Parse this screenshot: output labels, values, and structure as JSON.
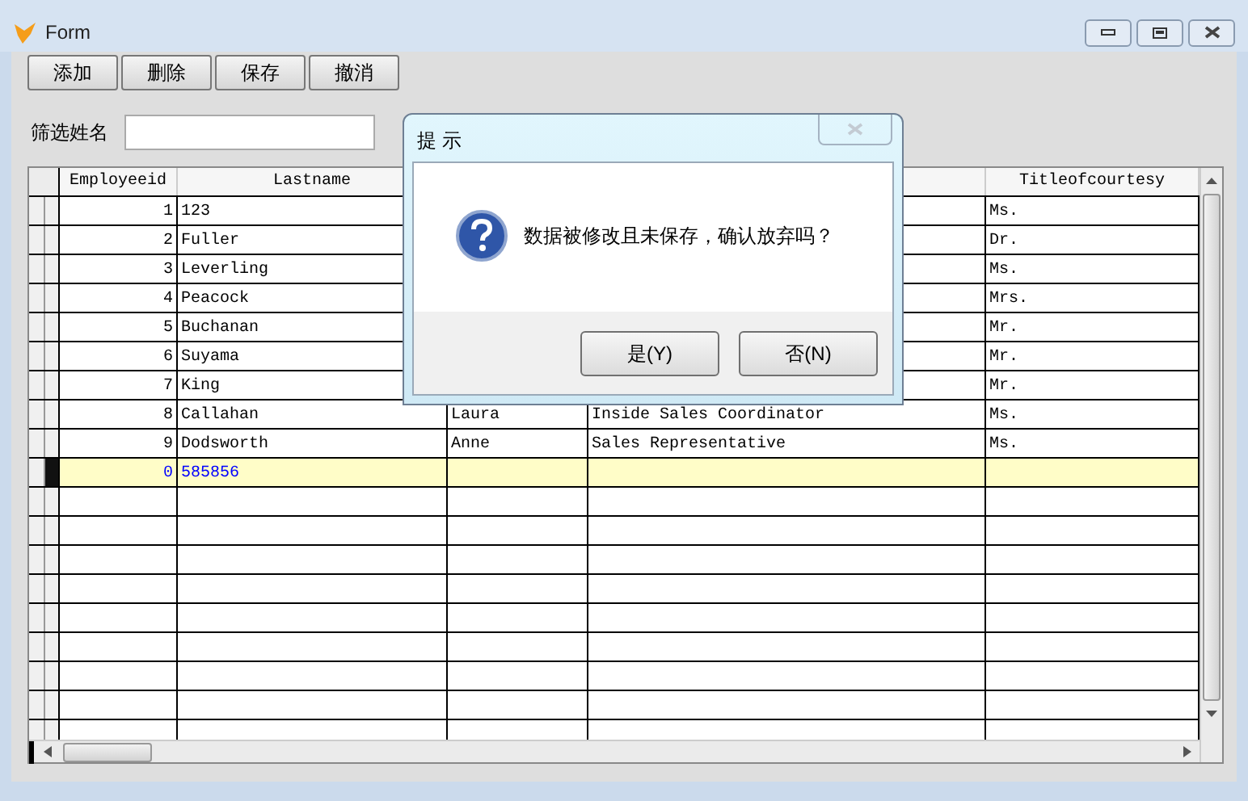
{
  "window": {
    "title": "Form"
  },
  "toolbar": [
    "添加",
    "删除",
    "保存",
    "撤消"
  ],
  "filter": {
    "label": "筛选姓名"
  },
  "table": {
    "headings": {
      "column_1": "Employeeid",
      "column_2": "Lastname",
      "column_5": "Titleofcourtesy"
    },
    "rows": [
      {
        "column_1": "1",
        "column_2": "123",
        "column_5": "Ms.",
        "selected": false
      },
      {
        "column_1": "2",
        "column_2": "Fuller",
        "column_5": "Dr.",
        "selected": false
      },
      {
        "column_1": "3",
        "column_2": "Leverling",
        "column_5": "Ms.",
        "selected": false
      },
      {
        "column_1": "4",
        "column_2": "Peacock",
        "column_5": "Mrs.",
        "selected": false
      },
      {
        "column_1": "5",
        "column_2": "Buchanan",
        "column_5": "Mr.",
        "selected": false
      },
      {
        "column_1": "6",
        "column_2": "Suyama",
        "column_5": "Mr.",
        "selected": false
      },
      {
        "column_1": "7",
        "column_2": "King",
        "column_5": "Mr.",
        "selected": false
      },
      {
        "column_1": "8",
        "column_2": "Callahan",
        "column_3": "Laura",
        "column_4": "Inside Sales Coordinator",
        "column_5": "Ms.",
        "selected": false
      },
      {
        "column_1": "9",
        "column_2": "Dodsworth",
        "column_3": "Anne",
        "column_4": "Sales Representative",
        "column_5": "Ms.",
        "selected": false
      },
      {
        "column_1": "0",
        "column_2": "585856",
        "selected": true
      }
    ]
  },
  "dialog": {
    "title": "提 示",
    "message": "数据被修改且未保存，确认放弃吗？",
    "buttons": [
      "是(Y)",
      "否(N)"
    ]
  }
}
